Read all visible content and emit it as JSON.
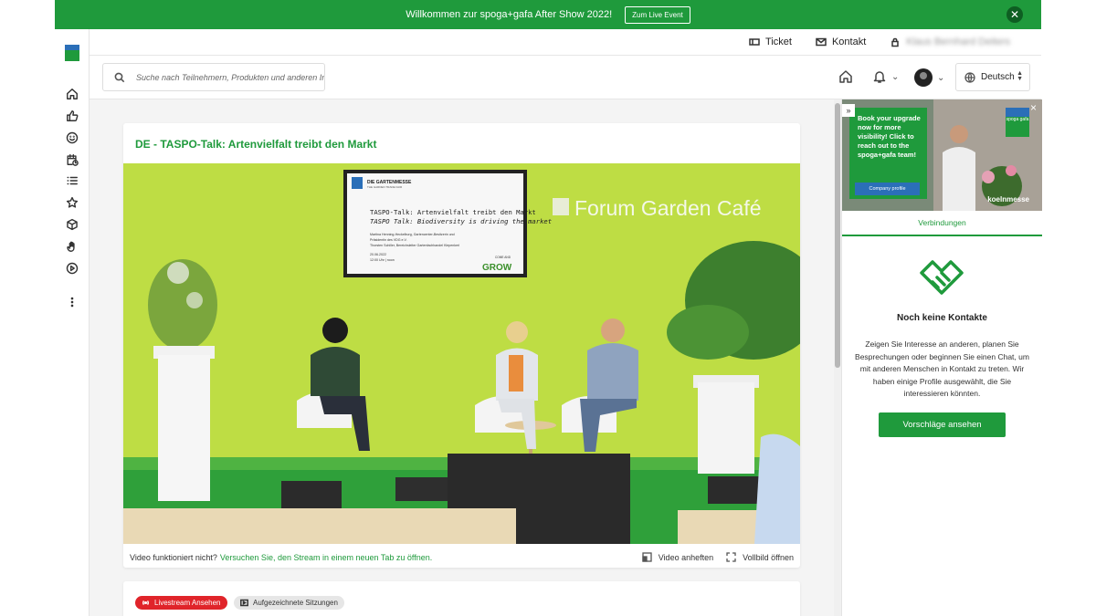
{
  "banner": {
    "message": "Willkommen zur spoga+gafa After Show 2022!",
    "button_label": "Zum Live Event",
    "close_glyph": "✕"
  },
  "topbar": {
    "ticket_label": "Ticket",
    "contact_label": "Kontakt",
    "user_name": "Klaus Bernhard Deiters"
  },
  "search": {
    "placeholder": "Suche nach Teilnehmern, Produkten und anderen Inhalten"
  },
  "language": {
    "current": "Deutsch"
  },
  "sidebar": {
    "icons": [
      "home-icon",
      "thumbs-up-icon",
      "smiley-icon",
      "calendar-clock-icon",
      "list-icon",
      "star-icon",
      "box-icon",
      "hand-icon",
      "play-icon",
      "more-vertical-icon"
    ]
  },
  "video_card": {
    "title": "DE - TASPO-Talk: Artenvielfalt treibt den Markt",
    "footer_question": "Video funktioniert nicht?",
    "footer_link": "Versuchen Sie, den Stream in einem neuen Tab zu öffnen.",
    "pin_label": "Video anheften",
    "fullscreen_label": "Vollbild öffnen"
  },
  "stream_card": {
    "live_label": "Livestream Ansehen",
    "recorded_label": "Aufgezeichnete Sitzungen"
  },
  "video_scene": {
    "screen_header": "DIE GARTENMESSE",
    "screen_subheader": "THE GARDEN TRADE FAIR",
    "screen_title_de": "TASPO-Talk: Artenvielfalt treibt den Markt",
    "screen_title_en": "TASPO Talk: Biodiversity is driving the market",
    "screen_line1": "Martina Henning-Heckelburg, Gartencenter-Besitzerin und",
    "screen_line2": "Präsidentin des VDG e.V.",
    "screen_line3": "Thorsten Schiller, Bereichsleiter Gartenfachhandel Klepenkerl",
    "screen_date": "20.06.2022",
    "screen_time": "12:00 Uhr | noon",
    "screen_logo_small": "COME AND",
    "screen_logo_big": "GROW",
    "wall_sign": "Forum Garden Café"
  },
  "ad": {
    "text": "Book your upgrade now for more visibility! Click to reach out to the spoga+gafa team!",
    "button": "Company profile",
    "brand": "koelnmesse",
    "logo_text": "spoga gafa"
  },
  "right_panel": {
    "tab_label": "Verbindungen",
    "empty_title": "Noch keine Kontakte",
    "empty_description": "Zeigen Sie Interesse an anderen, planen Sie Besprechungen oder beginnen Sie einen Chat, um mit anderen Menschen in Kontakt zu treten. Wir haben einige Profile ausgewählt, die Sie interessieren könnten.",
    "suggest_button": "Vorschläge ansehen"
  },
  "colors": {
    "brand_green": "#1f9a3c",
    "live_red": "#e0242a",
    "brand_blue": "#2b6fb8"
  }
}
